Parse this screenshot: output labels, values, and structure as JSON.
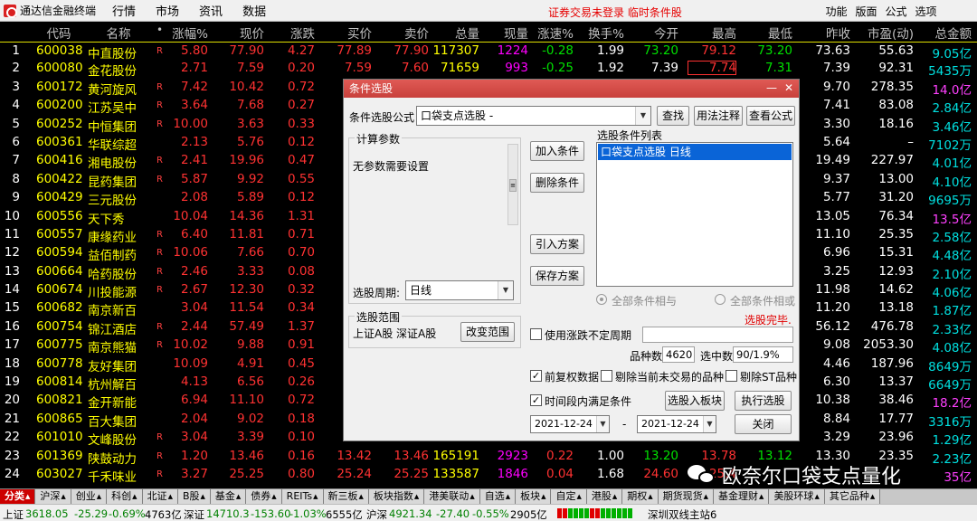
{
  "app": {
    "title": "通达信金融终端"
  },
  "menu": {
    "items": [
      "行情",
      "市场",
      "资讯",
      "数据"
    ],
    "status": "证券交易未登录  临时条件股",
    "right_items": [
      "功能",
      "版面",
      "公式",
      "选项"
    ]
  },
  "table": {
    "headers": {
      "code": "代码",
      "name": "名称",
      "dot": "•",
      "pct": "涨幅%",
      "price": "现价",
      "chg": "涨跌",
      "bid": "买价",
      "ask": "卖价",
      "vol": "总量",
      "cur": "现量",
      "spd": "涨速%",
      "turn": "换手%",
      "open": "今开",
      "high": "最高",
      "low": "最低",
      "prev": "昨收",
      "pe": "市盈(动)",
      "amt": "总金额"
    },
    "rows": [
      {
        "idx": "1",
        "code": "600038",
        "name": "中直股份",
        "flag": "R",
        "pct": "5.80",
        "price": "77.90",
        "chg": "4.27",
        "bid": "77.89",
        "ask": "77.90",
        "vol": "117307",
        "cur": "1224",
        "spd": "-0.28",
        "turn": "1.99",
        "open": "73.20",
        "high": "79.12",
        "low": "73.20",
        "prev": "73.63",
        "pe": "55.63",
        "amt": "9.05亿"
      },
      {
        "idx": "2",
        "code": "600080",
        "name": "金花股份",
        "flag": "",
        "pct": "2.71",
        "price": "7.59",
        "chg": "0.20",
        "bid": "7.59",
        "ask": "7.60",
        "vol": "71659",
        "cur": "993",
        "spd": "-0.25",
        "turn": "1.92",
        "open": "7.39",
        "high": "7.74",
        "low": "7.31",
        "prev": "7.39",
        "pe": "92.31",
        "amt": "5435万"
      },
      {
        "idx": "3",
        "code": "600172",
        "name": "黄河旋风",
        "flag": "R",
        "pct": "7.42",
        "price": "10.42",
        "chg": "0.72",
        "prev": "9.70",
        "pe": "278.35",
        "amt": "14.0亿"
      },
      {
        "idx": "4",
        "code": "600200",
        "name": "江苏吴中",
        "flag": "R",
        "pct": "3.64",
        "price": "7.68",
        "chg": "0.27",
        "prev": "7.41",
        "pe": "83.08",
        "amt": "2.84亿"
      },
      {
        "idx": "5",
        "code": "600252",
        "name": "中恒集团",
        "flag": "R",
        "pct": "10.00",
        "price": "3.63",
        "chg": "0.33",
        "prev": "3.30",
        "pe": "18.16",
        "amt": "3.46亿"
      },
      {
        "idx": "6",
        "code": "600361",
        "name": "华联综超",
        "flag": "",
        "pct": "2.13",
        "price": "5.76",
        "chg": "0.12",
        "prev": "5.64",
        "pe": "–",
        "amt": "7102万"
      },
      {
        "idx": "7",
        "code": "600416",
        "name": "湘电股份",
        "flag": "R",
        "pct": "2.41",
        "price": "19.96",
        "chg": "0.47",
        "prev": "19.49",
        "pe": "227.97",
        "amt": "4.01亿"
      },
      {
        "idx": "8",
        "code": "600422",
        "name": "昆药集团",
        "flag": "R",
        "pct": "5.87",
        "price": "9.92",
        "chg": "0.55",
        "prev": "9.37",
        "pe": "13.00",
        "amt": "4.10亿"
      },
      {
        "idx": "9",
        "code": "600429",
        "name": "三元股份",
        "flag": "",
        "pct": "2.08",
        "price": "5.89",
        "chg": "0.12",
        "prev": "5.77",
        "pe": "31.20",
        "amt": "9695万"
      },
      {
        "idx": "10",
        "code": "600556",
        "name": "天下秀",
        "flag": "",
        "pct": "10.04",
        "price": "14.36",
        "chg": "1.31",
        "prev": "13.05",
        "pe": "76.34",
        "amt": "13.5亿"
      },
      {
        "idx": "11",
        "code": "600557",
        "name": "康缘药业",
        "flag": "R",
        "pct": "6.40",
        "price": "11.81",
        "chg": "0.71",
        "prev": "11.10",
        "pe": "25.35",
        "amt": "2.58亿"
      },
      {
        "idx": "12",
        "code": "600594",
        "name": "益佰制药",
        "flag": "R",
        "pct": "10.06",
        "price": "7.66",
        "chg": "0.70",
        "prev": "6.96",
        "pe": "15.31",
        "amt": "4.48亿"
      },
      {
        "idx": "13",
        "code": "600664",
        "name": "哈药股份",
        "flag": "R",
        "pct": "2.46",
        "price": "3.33",
        "chg": "0.08",
        "prev": "3.25",
        "pe": "12.93",
        "amt": "2.10亿"
      },
      {
        "idx": "14",
        "code": "600674",
        "name": "川投能源",
        "flag": "R",
        "pct": "2.67",
        "price": "12.30",
        "chg": "0.32",
        "prev": "11.98",
        "pe": "14.62",
        "amt": "4.06亿"
      },
      {
        "idx": "15",
        "code": "600682",
        "name": "南京新百",
        "flag": "",
        "pct": "3.04",
        "price": "11.54",
        "chg": "0.34",
        "prev": "11.20",
        "pe": "13.18",
        "amt": "1.87亿"
      },
      {
        "idx": "16",
        "code": "600754",
        "name": "锦江酒店",
        "flag": "R",
        "pct": "2.44",
        "price": "57.49",
        "chg": "1.37",
        "prev": "56.12",
        "pe": "476.78",
        "amt": "2.33亿"
      },
      {
        "idx": "17",
        "code": "600775",
        "name": "南京熊猫",
        "flag": "R",
        "pct": "10.02",
        "price": "9.88",
        "chg": "0.91",
        "prev": "9.08",
        "pe": "2053.30",
        "amt": "4.08亿"
      },
      {
        "idx": "18",
        "code": "600778",
        "name": "友好集团",
        "flag": "",
        "pct": "10.09",
        "price": "4.91",
        "chg": "0.45",
        "prev": "4.46",
        "pe": "187.96",
        "amt": "8649万"
      },
      {
        "idx": "19",
        "code": "600814",
        "name": "杭州解百",
        "flag": "",
        "pct": "4.13",
        "price": "6.56",
        "chg": "0.26",
        "prev": "6.30",
        "pe": "13.37",
        "amt": "6649万"
      },
      {
        "idx": "20",
        "code": "600821",
        "name": "金开新能",
        "flag": "",
        "pct": "6.94",
        "price": "11.10",
        "chg": "0.72",
        "prev": "10.38",
        "pe": "38.46",
        "amt": "18.2亿"
      },
      {
        "idx": "21",
        "code": "600865",
        "name": "百大集团",
        "flag": "",
        "pct": "2.04",
        "price": "9.02",
        "chg": "0.18",
        "prev": "8.84",
        "pe": "17.77",
        "amt": "3316万"
      },
      {
        "idx": "22",
        "code": "601010",
        "name": "文峰股份",
        "flag": "R",
        "pct": "3.04",
        "price": "3.39",
        "chg": "0.10",
        "prev": "3.29",
        "pe": "23.96",
        "amt": "1.29亿"
      },
      {
        "idx": "23",
        "code": "601369",
        "name": "陕鼓动力",
        "flag": "R",
        "pct": "1.20",
        "price": "13.46",
        "chg": "0.16",
        "bid": "13.42",
        "ask": "13.46",
        "vol": "165191",
        "cur": "2923",
        "spd": "0.22",
        "turn": "1.00",
        "open": "13.20",
        "high": "13.78",
        "low": "13.12",
        "prev": "13.30",
        "pe": "23.35",
        "amt": "2.23亿"
      },
      {
        "idx": "24",
        "code": "603027",
        "name": "千禾味业",
        "flag": "R",
        "pct": "3.27",
        "price": "25.25",
        "chg": "0.80",
        "bid": "25.24",
        "ask": "25.25",
        "vol": "133587",
        "cur": "1846",
        "spd": "0.04",
        "turn": "1.68",
        "open": "24.60",
        "high": "25.4",
        "low": "",
        "prev": "",
        "pe": "",
        "amt": "35亿"
      }
    ]
  },
  "tabs": [
    "分类",
    "沪深",
    "创业",
    "科创",
    "北证",
    "B股",
    "基金",
    "债券",
    "REITs",
    "新三板",
    "板块指数",
    "港美联动",
    "自选",
    "板块",
    "自定",
    "港股",
    "期权",
    "期货现货",
    "基金理财",
    "美股环球",
    "其它品种"
  ],
  "status": {
    "sh_label": "上证",
    "sh_val": "3618.05",
    "sh_chg": "-25.29",
    "sh_pct": "-0.69%",
    "sh_amt": "4763亿",
    "sz_label": "深证",
    "sz_val": "14710.3",
    "sz_chg": "-153.60",
    "sz_pct": "-1.03%",
    "sz_amt": "6555亿",
    "hs_label": "沪深",
    "hs_val": "4921.34",
    "hs_chg": "-27.40",
    "hs_pct": "-0.55%",
    "hs_amt": "2905亿",
    "server": "深圳双线主站6"
  },
  "dialog": {
    "title": "条件选股",
    "formula_label": "条件选股公式",
    "formula_value": "口袋支点选股 -",
    "btn_find": "查找",
    "btn_usage": "用法注释",
    "btn_view": "查看公式",
    "params_group": "计算参数",
    "params_text": "无参数需要设置",
    "btn_add": "加入条件",
    "btn_delete": "删除条件",
    "btn_import": "引入方案",
    "btn_save": "保存方案",
    "conditions_label": "选股条件列表",
    "conditions": [
      "口袋支点选股  日线"
    ],
    "period_label": "选股周期:",
    "period_value": "日线",
    "radio_and": "全部条件相与",
    "radio_or": "全部条件相或",
    "done_text": "选股完毕.",
    "scope_group": "选股范围",
    "scope_text": "上证A股 深证A股",
    "btn_scope": "改变范围",
    "cb_period": "使用涨跌不定周期",
    "count_label": "品种数",
    "count_value": "4620",
    "selected_label": "选中数",
    "selected_value": "90/1.9%",
    "cb_adjust": "前复权数据",
    "cb_exclude_no_trade": "剔除当前未交易的品种",
    "cb_exclude_st": "剔除ST品种",
    "cb_time": "时间段内满足条件",
    "btn_to_block": "选股入板块",
    "btn_run": "执行选股",
    "date_from": "2021-12-24",
    "date_sep": "-",
    "date_to": "2021-12-24",
    "btn_close": "关闭"
  },
  "watermark": {
    "text": "欧奈尔口袋支点量化"
  }
}
